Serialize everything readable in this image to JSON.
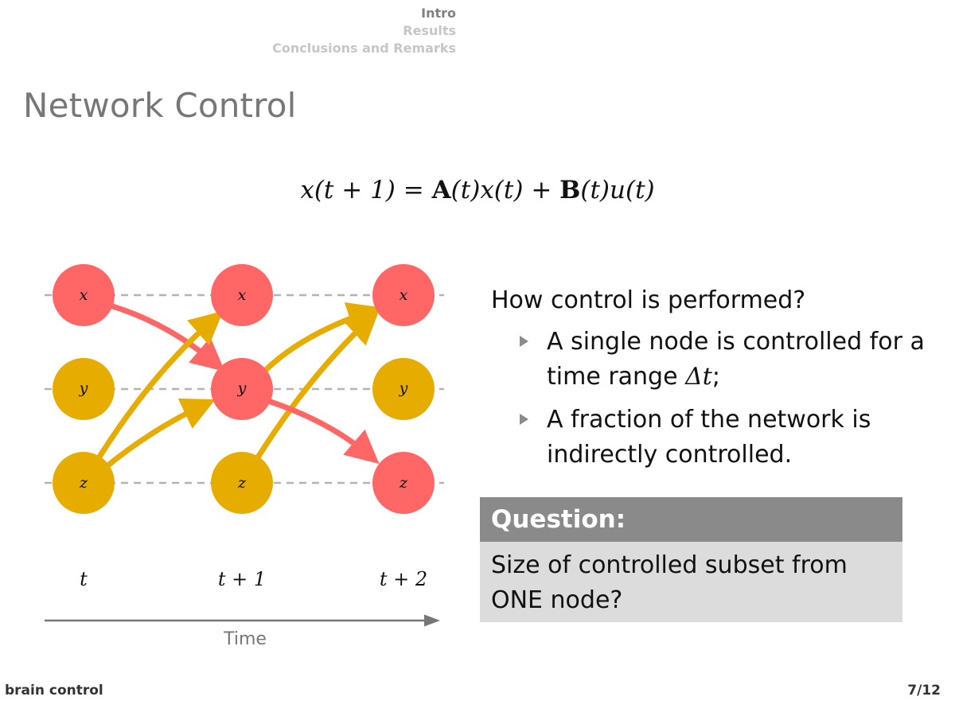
{
  "nav": {
    "items": [
      "Intro",
      "Results",
      "Conclusions and Remarks"
    ],
    "active_index": 0
  },
  "slide": {
    "title": "Network Control"
  },
  "equation": {
    "lhs": "x(t + 1)",
    "eq": "=",
    "A": "A",
    "term1_rest": "(t)x(t)",
    "plus": "+",
    "B": "B",
    "term2_rest": "(t)u(t)"
  },
  "diagram": {
    "nodes": {
      "col_t": [
        "x",
        "y",
        "z"
      ],
      "col_t1": [
        "x",
        "y",
        "z"
      ],
      "col_t2": [
        "x",
        "y",
        "z"
      ]
    },
    "time_labels": [
      "t",
      "t + 1",
      "t + 2"
    ],
    "axis_label": "Time",
    "colors": {
      "controlled": "#ff6666",
      "uncontrolled": "#e6ac00",
      "gridline": "#b3b3b3",
      "axis": "#777777"
    }
  },
  "content": {
    "question_lead": "How control is performed?",
    "bullet1_text": "A single node is controlled for a time range ",
    "bullet1_math": "Δt",
    "bullet1_end": ";",
    "bullet2_text": "A fraction of the network is indirectly controlled."
  },
  "block": {
    "title": "Question:",
    "body": "Size of controlled subset from ONE node?"
  },
  "footer": {
    "left": "brain control",
    "right": "7/12"
  }
}
